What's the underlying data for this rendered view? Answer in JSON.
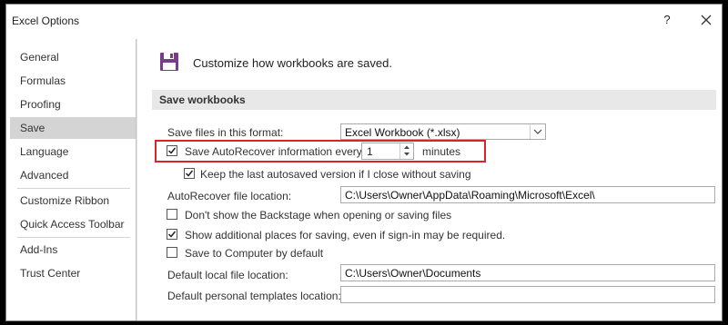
{
  "window": {
    "title": "Excel Options",
    "help_label": "?"
  },
  "sidebar": {
    "items": [
      {
        "label": "General"
      },
      {
        "label": "Formulas"
      },
      {
        "label": "Proofing"
      },
      {
        "label": "Save",
        "selected": true
      },
      {
        "label": "Language"
      },
      {
        "label": "Advanced"
      },
      {
        "label": "Customize Ribbon"
      },
      {
        "label": "Quick Access Toolbar"
      },
      {
        "label": "Add-Ins"
      },
      {
        "label": "Trust Center"
      }
    ]
  },
  "main": {
    "header": "Customize how workbooks are saved.",
    "section_title": "Save workbooks",
    "save_format": {
      "label": "Save files in this format:",
      "value": "Excel Workbook (*.xlsx)"
    },
    "autorecover": {
      "label": "Save AutoRecover information every",
      "value": "1",
      "unit": "minutes",
      "checked": true
    },
    "keep_last": {
      "label": "Keep the last autosaved version if I close without saving",
      "checked": true
    },
    "autorecover_location": {
      "label": "AutoRecover file location:",
      "value": "C:\\Users\\Owner\\AppData\\Roaming\\Microsoft\\Excel\\"
    },
    "dont_show_backstage": {
      "label": "Don't show the Backstage when opening or saving files",
      "checked": false
    },
    "show_additional": {
      "label": "Show additional places for saving, even if sign-in may be required.",
      "checked": true
    },
    "save_to_computer": {
      "label": "Save to Computer by default",
      "checked": false
    },
    "default_local": {
      "label": "Default local file location:",
      "value": "C:\\Users\\Owner\\Documents"
    },
    "default_templates": {
      "label": "Default personal templates location:",
      "value": ""
    }
  },
  "colors": {
    "highlight_border": "#d9242b",
    "selected_item": "#d4d4d4",
    "section_band": "#e8e8e8",
    "save_icon": "#7a3b8c"
  },
  "icons": [
    "close-icon",
    "floppy-disk-icon",
    "checkmark-icon",
    "dropdown-arrow-icon",
    "spin-up-icon",
    "spin-down-icon"
  ]
}
